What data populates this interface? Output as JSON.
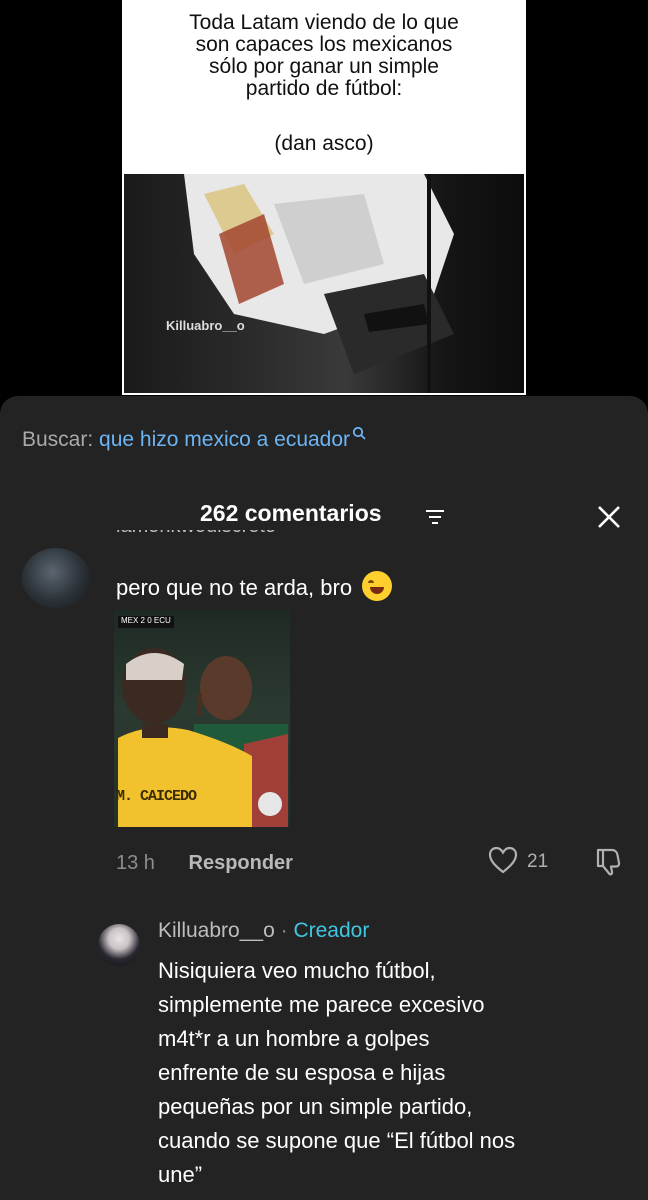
{
  "video": {
    "meme_caption": "Toda Latam viendo de lo que\nson capaces los mexicanos\nsólo por ganar un simple\npartido de fútbol:",
    "meme_subcaption": "(dan asco)",
    "watermark": "Killuabro__o"
  },
  "search": {
    "label": "Buscar:",
    "query": "que hizo mexico a ecuador",
    "icon": "search-icon"
  },
  "header": {
    "comment_count": "262 comentarios",
    "sort_icon": "filter-lines-icon",
    "close_icon": "close-icon"
  },
  "comments": [
    {
      "username_partial": "lamonkwodiscreto",
      "text": "pero que no te arda, bro",
      "emoji": "laughing-tears-emoji",
      "image": {
        "scoreboard": "MEX 2 0 ECU",
        "jersey_text": "M. CAICEDO"
      },
      "time": "13 h",
      "reply_label": "Responder",
      "likes": "21"
    }
  ],
  "reply": {
    "username": "Killuabro__o",
    "separator": "·",
    "badge": "Creador",
    "text": "Nisiquiera veo mucho fútbol,\nsimplemente me parece excesivo\nm4t*r a un hombre a golpes\nenfrente de su esposa e hijas\npequeñas por un simple partido,\ncuando se supone que “El fútbol nos\nune”"
  },
  "colors": {
    "sheet_bg": "#232323",
    "link_blue": "#6cb4f2",
    "creator_cyan": "#41c6e2",
    "muted_text": "#8d8d8d"
  }
}
